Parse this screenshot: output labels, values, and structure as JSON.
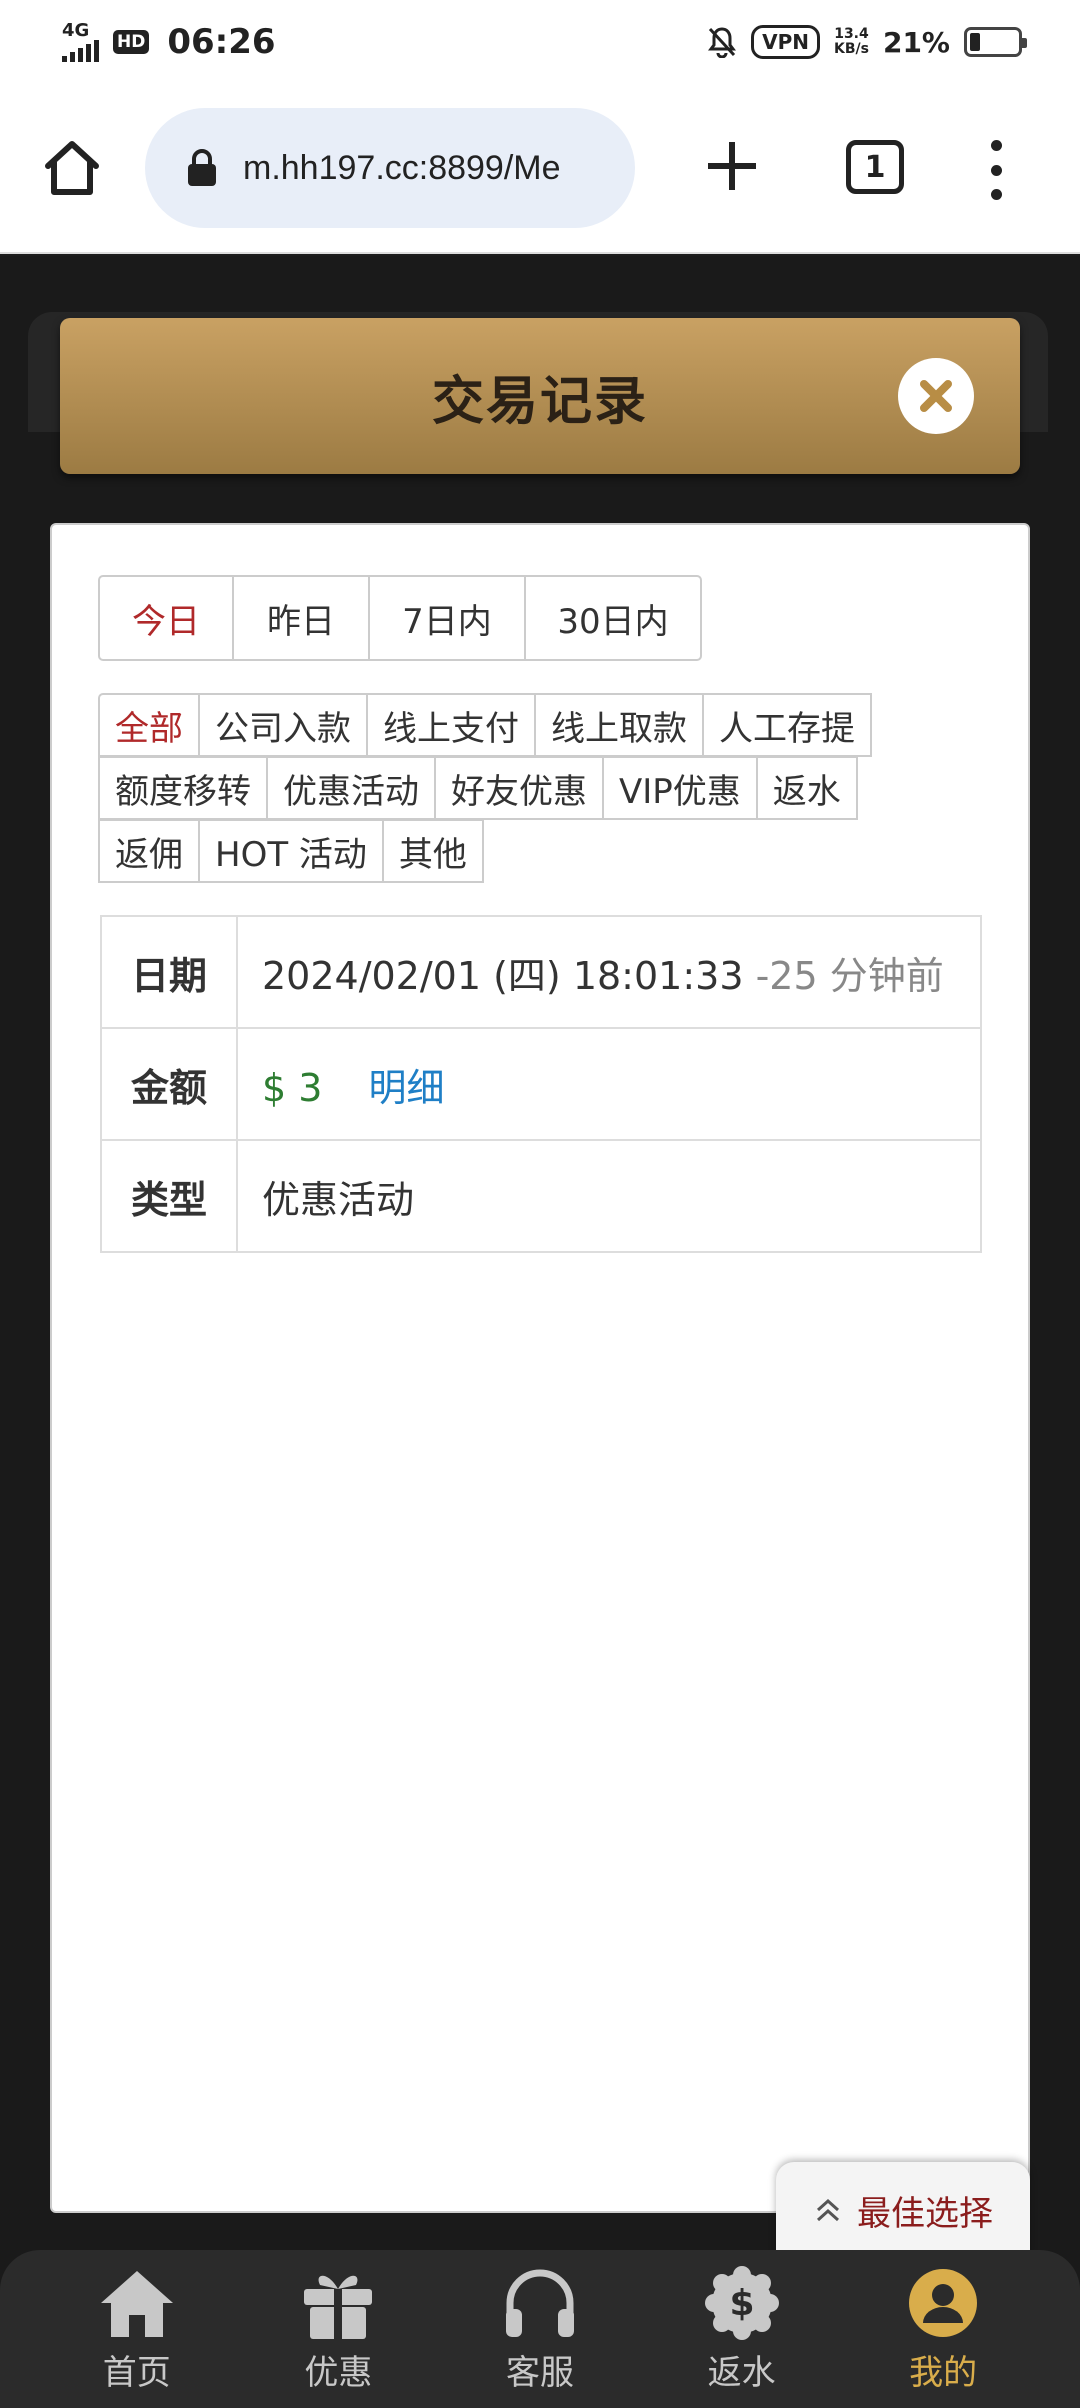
{
  "status_bar": {
    "network": "4G",
    "hd": "HD",
    "time": "06:26",
    "vpn": "VPN",
    "speed_value": "13.4",
    "speed_unit": "KB/s",
    "battery": "21%",
    "battery_level": 0.21
  },
  "browser": {
    "url": "m.hh197.cc:8899/Me",
    "tab_count": "1"
  },
  "modal": {
    "title": "交易记录"
  },
  "date_filters": [
    {
      "label": "今日",
      "active": true
    },
    {
      "label": "昨日",
      "active": false
    },
    {
      "label": "7日内",
      "active": false
    },
    {
      "label": "30日内",
      "active": false
    }
  ],
  "type_filters": [
    [
      "全部",
      "公司入款",
      "线上支付",
      "线上取款",
      "人工存提"
    ],
    [
      "额度移转",
      "优惠活动",
      "好友优惠",
      "VIP优惠",
      "返水"
    ],
    [
      "返佣",
      "HOT 活动",
      "其他"
    ]
  ],
  "record": {
    "date_label": "日期",
    "date_value": "2024/02/01 (四) 18:01:33",
    "date_ago": "-25 分钟前",
    "amount_label": "金额",
    "amount_value": "$ 3",
    "detail_link": "明细",
    "type_label": "类型",
    "type_value": "优惠活动"
  },
  "best_choice": "最佳选择",
  "bottom_nav": [
    {
      "label": "首页",
      "icon": "home-icon",
      "active": false
    },
    {
      "label": "优惠",
      "icon": "gift-icon",
      "active": false
    },
    {
      "label": "客服",
      "icon": "headset-icon",
      "active": false
    },
    {
      "label": "返水",
      "icon": "dollar-badge-icon",
      "active": false
    },
    {
      "label": "我的",
      "icon": "user-icon",
      "active": true
    }
  ],
  "colors": {
    "accent": "#c9a163",
    "active_text": "#b0292a",
    "amount": "#2e7d32",
    "link": "#1f7fc6",
    "nav_active": "#d9ad4b"
  }
}
